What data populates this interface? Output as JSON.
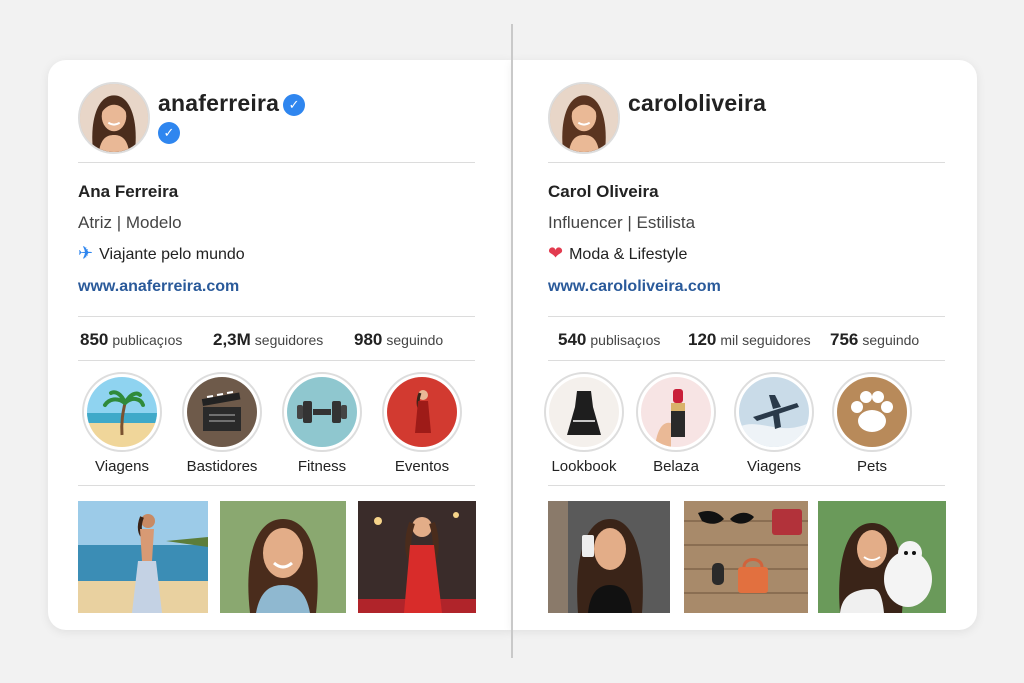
{
  "profiles": [
    {
      "username": "anaferreira",
      "verified": true,
      "name": "Ana Ferreira",
      "bio_line1": "Atriz | Modelo",
      "bio_line2_icon": "airplane-icon",
      "bio_line2": "Viajante pelo mundo",
      "website": "www.anaferreira.com",
      "stats": {
        "posts_count": "850",
        "posts_label": "publicaçıos",
        "followers_count": "2,3M",
        "followers_label": "seguidores",
        "following_count": "980",
        "following_label": "seguindo"
      },
      "highlights": [
        "Viagens",
        "Bastidores",
        "Fitness",
        "Eventos"
      ]
    },
    {
      "username": "carololiveira",
      "verified": false,
      "name": "Carol Oliveira",
      "bio_line1": "Influencer | Estilista",
      "bio_line2_icon": "heart-icon",
      "bio_line2": "Moda & Lifestyle",
      "website": "www.carololiveira.com",
      "stats": {
        "posts_count": "540",
        "posts_label": "publisaçıos",
        "followers_count": "120",
        "followers_label": "mil seguidores",
        "following_count": "756",
        "following_label": "seguindo"
      },
      "highlights": [
        "Lookbook",
        "Belaza",
        "Viagens",
        "Pets"
      ]
    }
  ],
  "colors": {
    "verified_blue": "#2f86ef",
    "link_blue": "#2a5a9a",
    "heart_red": "#e23b4f"
  }
}
